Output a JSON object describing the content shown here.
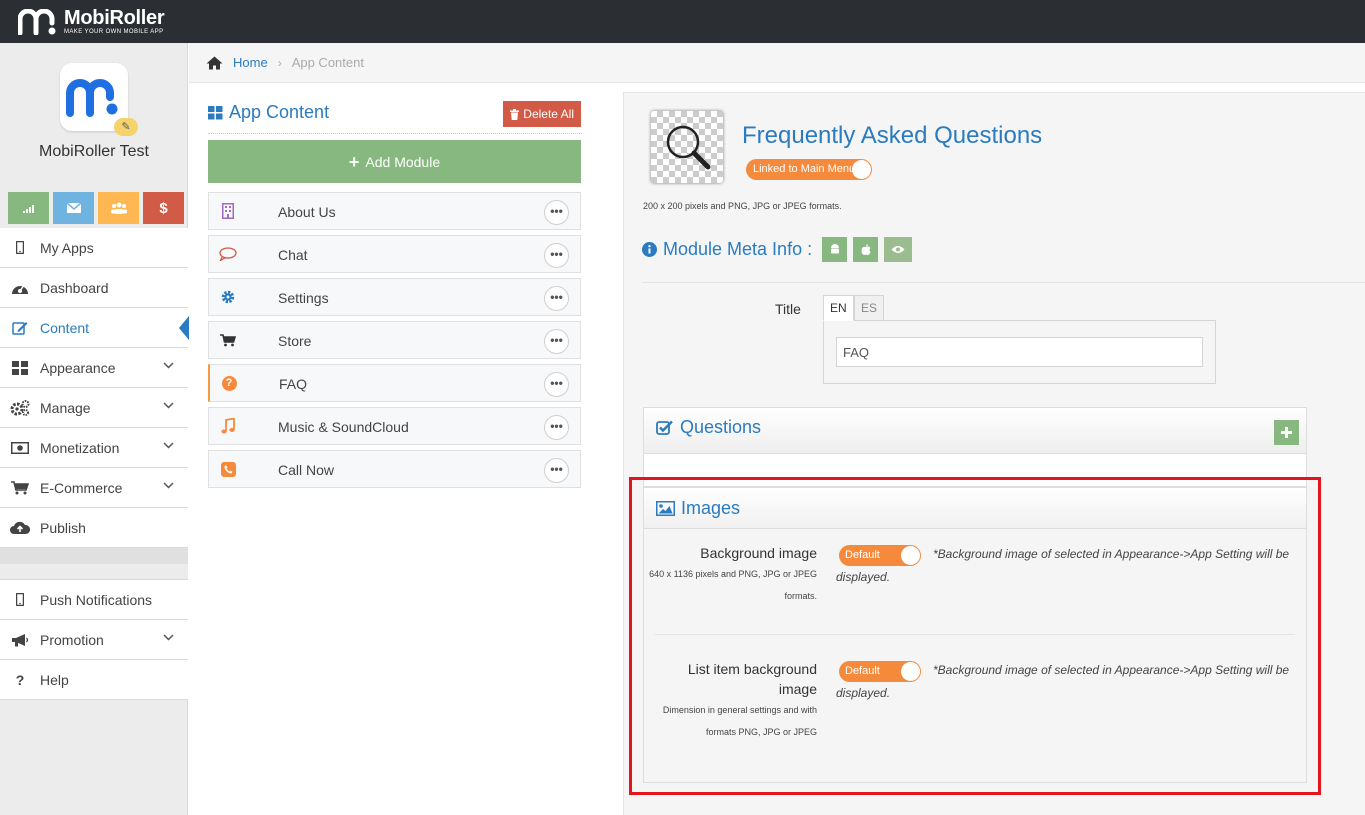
{
  "brand": {
    "name": "MobiRoller",
    "tagline": "MAKE YOUR OWN MOBILE APP"
  },
  "app": {
    "name": "MobiRoller Test"
  },
  "quick_buttons": [
    {
      "icon": "signal-icon",
      "color": "#87b87f"
    },
    {
      "icon": "envelope-icon",
      "color": "#6fb3e0"
    },
    {
      "icon": "users-icon",
      "color": "#ffb752"
    },
    {
      "icon": "dollar-icon",
      "color": "#d15b47"
    }
  ],
  "nav": {
    "my_apps": "My Apps",
    "dashboard": "Dashboard",
    "content": "Content",
    "appearance": "Appearance",
    "manage": "Manage",
    "monetization": "Monetization",
    "ecommerce": "E-Commerce",
    "publish": "Publish",
    "push_notifications": "Push Notifications",
    "promotion": "Promotion",
    "help": "Help"
  },
  "breadcrumb": {
    "home": "Home",
    "current": "App Content"
  },
  "app_content": {
    "title": "App Content",
    "delete_all": "Delete All",
    "add_module": "Add Module",
    "modules": [
      {
        "name": "About Us",
        "icon": "building-icon",
        "color": "#a069c3"
      },
      {
        "name": "Chat",
        "icon": "chat-bubble-icon",
        "color": "#d15b47"
      },
      {
        "name": "Settings",
        "icon": "gear-icon",
        "color": "#2a7bbf"
      },
      {
        "name": "Store",
        "icon": "cart-icon",
        "color": "#333333"
      },
      {
        "name": "FAQ",
        "icon": "question-circle-icon",
        "color": "#f58a3c"
      },
      {
        "name": "Music & SoundCloud",
        "icon": "music-note-icon",
        "color": "#f58a3c"
      },
      {
        "name": "Call Now",
        "icon": "phone-icon",
        "color": "#f58a3c"
      }
    ]
  },
  "module": {
    "title": "Frequently Asked Questions",
    "linked_toggle": "Linked to Main Menu",
    "icon_hint": "200 x 200 pixels and PNG, JPG or JPEG formats.",
    "meta_title": "Module Meta Info :",
    "title_label": "Title",
    "lang_tabs": [
      "EN",
      "ES"
    ],
    "title_value": "FAQ"
  },
  "questions": {
    "title": "Questions"
  },
  "images": {
    "title": "Images",
    "background": {
      "label": "Background image",
      "hint": "640 x 1136 pixels and PNG, JPG or JPEG formats.",
      "toggle": "Default",
      "note": "*Background image of selected in Appearance->App Setting will be displayed."
    },
    "list_item": {
      "label": "List item background image",
      "hint": "Dimension in general settings and with formats PNG, JPG or JPEG",
      "toggle": "Default",
      "note": "*Background image of selected in Appearance->App Setting will be displayed."
    }
  },
  "colors": {
    "accent": "#2a7bbf",
    "success": "#87b87f",
    "danger": "#d15b47",
    "toggle": "#f58a3c",
    "highlight": "#e3141e"
  }
}
